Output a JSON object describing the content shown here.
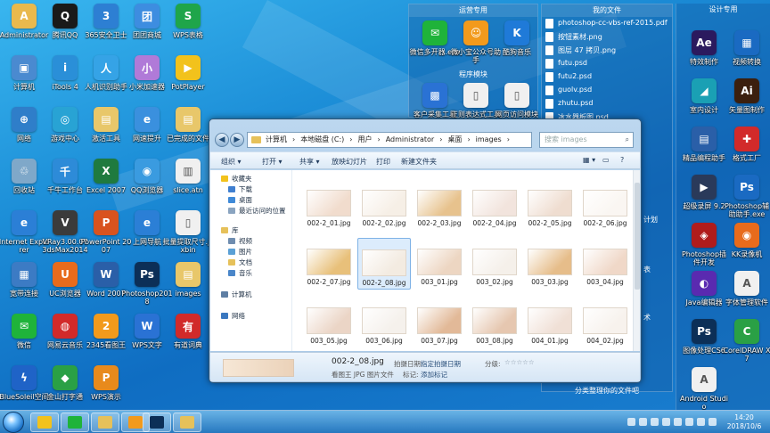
{
  "desktop_left": [
    {
      "label": "Administrator",
      "color": "#e9b94d",
      "glyph": "A"
    },
    {
      "label": "腾讯QQ",
      "color": "#1a1a1a",
      "glyph": "Q"
    },
    {
      "label": "365安全卫士",
      "color": "#2d7fd3",
      "glyph": "3"
    },
    {
      "label": "团团商城",
      "color": "#3d8de0",
      "glyph": "团"
    },
    {
      "label": "WPS表格",
      "color": "#1fa54a",
      "glyph": "S"
    },
    {
      "label": "计算机",
      "color": "#4a8ad0",
      "glyph": "▣"
    },
    {
      "label": "iTools 4",
      "color": "#2a8fd8",
      "glyph": "i"
    },
    {
      "label": "人机识别助手",
      "color": "#35a3e6",
      "glyph": "人"
    },
    {
      "label": "小米加速器",
      "color": "#b07ad8",
      "glyph": "小"
    },
    {
      "label": "PotPlayer",
      "color": "#f2c21c",
      "glyph": "▶"
    },
    {
      "label": "网络",
      "color": "#2f7ec9",
      "glyph": "⊕"
    },
    {
      "label": "游戏中心",
      "color": "#28a3d4",
      "glyph": "◎"
    },
    {
      "label": "激活工具",
      "color": "#e8c76a",
      "glyph": "▤"
    },
    {
      "label": "网速提升",
      "color": "#3a90de",
      "glyph": "e"
    },
    {
      "label": "已完成的文件",
      "color": "#e8c76a",
      "glyph": "▤"
    },
    {
      "label": "回收站",
      "color": "#7fa8c9",
      "glyph": "♲"
    },
    {
      "label": "千牛工作台",
      "color": "#2d8bd8",
      "glyph": "千"
    },
    {
      "label": "Excel 2007",
      "color": "#1f7a3f",
      "glyph": "X"
    },
    {
      "label": "QQ浏览器",
      "color": "#3a9be0",
      "glyph": "◉"
    },
    {
      "label": "slice.atn",
      "color": "#f0f0f0",
      "glyph": "▥"
    },
    {
      "label": "Internet Explorer",
      "color": "#2b7fd6",
      "glyph": "e"
    },
    {
      "label": "VRay3.00.07 3dsMax2014",
      "color": "#3b3b3b",
      "glyph": "V"
    },
    {
      "label": "PowerPoint 2007",
      "color": "#d9531e",
      "glyph": "P"
    },
    {
      "label": "上网导航",
      "color": "#2b7fd6",
      "glyph": "e"
    },
    {
      "label": "批量提取尺寸.jsxbin",
      "color": "#f0f0f0",
      "glyph": "▯"
    },
    {
      "label": "宽带连接",
      "color": "#3c7bc4",
      "glyph": "▦"
    },
    {
      "label": "UC浏览器",
      "color": "#e86b1c",
      "glyph": "U"
    },
    {
      "label": "Word 2007",
      "color": "#2a5fa8",
      "glyph": "W"
    },
    {
      "label": "Photoshop2018",
      "color": "#0c2f57",
      "glyph": "Ps"
    },
    {
      "label": "images",
      "color": "#e8c76a",
      "glyph": "▤"
    },
    {
      "label": "微信",
      "color": "#1fb33a",
      "glyph": "✉"
    },
    {
      "label": "网易云音乐",
      "color": "#d22a2a",
      "glyph": "◍"
    },
    {
      "label": "2345看图王",
      "color": "#f29a1c",
      "glyph": "2"
    },
    {
      "label": "WPS文字",
      "color": "#2a72d4",
      "glyph": "W"
    },
    {
      "label": "有道词典",
      "color": "#d12a2a",
      "glyph": "有"
    },
    {
      "label": "BlueSoleil空间",
      "color": "#1f63c7",
      "glyph": "ϟ"
    },
    {
      "label": "金山打字通",
      "color": "#2aa045",
      "glyph": "◆"
    },
    {
      "label": "WPS演示",
      "color": "#e88a1c",
      "glyph": "P"
    }
  ],
  "fence_apps": {
    "title": "运营专用",
    "items": [
      {
        "label": "微信多开器.exe",
        "color": "#1fb33a",
        "glyph": "✉"
      },
      {
        "label": "微小宝公众号助手",
        "color": "#f29a1c",
        "glyph": "☺"
      },
      {
        "label": "酷狗音乐",
        "color": "#1f7ad8",
        "glyph": "K"
      }
    ],
    "sub_title": "程序模块",
    "sub_items": [
      {
        "label": "客户采集工具",
        "color": "#2a72d4",
        "glyph": "▩"
      },
      {
        "label": "正则表达式工具",
        "color": "#f0f0f0",
        "glyph": "▯"
      },
      {
        "label": "网页访问模块",
        "color": "#f0f0f0",
        "glyph": "▯"
      }
    ]
  },
  "fence_docs": {
    "title": "我的文件",
    "items": [
      "photoshop-cc-vbs-ref-2015.pdf",
      "按钮素材.png",
      "图层 47 拷贝.png",
      "futu.psd",
      "futu2.psd",
      "guolv.psd",
      "zhutu.psd",
      "冰水器板图.psd"
    ],
    "right_labels": [
      "计划",
      "表",
      "术"
    ],
    "footer": "分类整理你的文件吧"
  },
  "desktop_right": {
    "title": "设计专用",
    "items": [
      {
        "label": "特效制作",
        "color": "#2b1a5e",
        "glyph": "Ae"
      },
      {
        "label": "视频转换",
        "color": "#1a6ac2",
        "glyph": "▦"
      },
      {
        "label": "室内设计",
        "color": "#1aa0b4",
        "glyph": "◢"
      },
      {
        "label": "矢量图制作",
        "color": "#3b1f0e",
        "glyph": "Ai"
      },
      {
        "label": "精品编程助手",
        "color": "#2a5fa8",
        "glyph": "▤"
      },
      {
        "label": "格式工厂",
        "color": "#d22a2a",
        "glyph": "✚"
      },
      {
        "label": "超级录屏 9.2",
        "color": "#2a3a5a",
        "glyph": "▶"
      },
      {
        "label": "Photoshop辅助助手.exe",
        "color": "#1a6ac2",
        "glyph": "Ps"
      },
      {
        "label": "Photoshop插件开发",
        "color": "#b01c1c",
        "glyph": "◈"
      },
      {
        "label": "KK录像机",
        "color": "#e86b1c",
        "glyph": "◉"
      },
      {
        "label": "Java编辑器",
        "color": "#5a2ab0",
        "glyph": "◐"
      },
      {
        "label": "字体管理软件",
        "color": "#f0f0f0",
        "glyph": "A"
      },
      {
        "label": "图像处理CS6",
        "color": "#0c2f57",
        "glyph": "Ps"
      },
      {
        "label": "CorelDRAW X7",
        "color": "#2aa045",
        "glyph": "C"
      },
      {
        "label": "Android Studio",
        "color": "#f0f0f0",
        "glyph": "A"
      }
    ]
  },
  "window": {
    "address": [
      "计算机",
      "本地磁盘 (C:)",
      "用户",
      "Administrator",
      "桌面",
      "images"
    ],
    "search_placeholder": "搜索 images",
    "toolbar": [
      "组织 ▾",
      "打开 ▾",
      "共享 ▾",
      "放映幻灯片",
      "打印",
      "新建文件夹"
    ],
    "nav": {
      "favorites": "收藏夹",
      "fav_items": [
        "下载",
        "桌面",
        "最近访问的位置"
      ],
      "libraries": "库",
      "lib_items": [
        "视频",
        "图片",
        "文档",
        "音乐"
      ],
      "computer": "计算机",
      "network": "网络"
    },
    "files": [
      {
        "name": "002-2_01.jpg",
        "tone": "#f1dccd"
      },
      {
        "name": "002-2_02.jpg",
        "tone": "#f6efe6"
      },
      {
        "name": "002-2_03.jpg",
        "tone": "#e7c28d"
      },
      {
        "name": "002-2_04.jpg",
        "tone": "#f2e4dd"
      },
      {
        "name": "002-2_05.jpg",
        "tone": "#efddd0"
      },
      {
        "name": "002-2_06.jpg",
        "tone": "#faf6f2"
      },
      {
        "name": "002-2_07.jpg",
        "tone": "#e8c07a"
      },
      {
        "name": "002-2_08.jpg",
        "tone": "#f3ebe1"
      },
      {
        "name": "003_01.jpg",
        "tone": "#edd6c2"
      },
      {
        "name": "003_02.jpg",
        "tone": "#f5f0ea"
      },
      {
        "name": "003_03.jpg",
        "tone": "#e6bd8a"
      },
      {
        "name": "003_04.jpg",
        "tone": "#f0d8c8"
      },
      {
        "name": "003_05.jpg",
        "tone": "#ebd5c6"
      },
      {
        "name": "003_06.jpg",
        "tone": "#f5f1ec"
      },
      {
        "name": "003_07.jpg",
        "tone": "#e2b998"
      },
      {
        "name": "003_08.jpg",
        "tone": "#e6c7b0"
      },
      {
        "name": "004_01.jpg",
        "tone": "#f0e0d6"
      },
      {
        "name": "004_02.jpg",
        "tone": "#f7f2ed"
      }
    ],
    "selected_index": 7,
    "details": {
      "filename": "002-2_08.jpg",
      "type": "看图王 JPG 图片文件",
      "date_label": "拍摄日期:",
      "date_value": "指定拍摄日期",
      "tags_label": "标记:",
      "tags_value": "添加标记",
      "rating_label": "分级:",
      "stars": "☆☆☆☆☆"
    }
  },
  "taskbar": {
    "time": "14:20",
    "date": "2018/10/6"
  }
}
